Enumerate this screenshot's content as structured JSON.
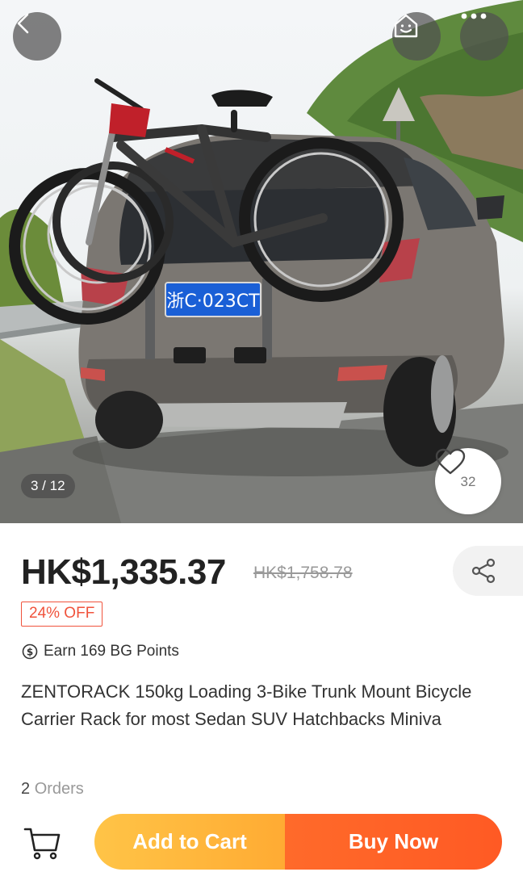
{
  "gallery": {
    "counter": "3 / 12",
    "plate_text": "浙C·023CT",
    "favorite_count": "32"
  },
  "product": {
    "price": "HK$1,335.37",
    "original_price": "HK$1,758.78",
    "discount": "24% OFF",
    "points": "Earn 169 BG Points",
    "title": "ZENTORACK 150kg Loading 3-Bike Trunk Mount Bicycle Carrier Rack for most Sedan SUV Hatchbacks Miniva",
    "orders_count": "2",
    "orders_label": "Orders"
  },
  "actions": {
    "add_to_cart": "Add to Cart",
    "buy_now": "Buy Now"
  },
  "icons": {
    "back": "chevron-left-icon",
    "home": "home-face-icon",
    "more": "more-dots-icon",
    "favorite": "heart-icon",
    "share": "share-icon",
    "points": "coin-icon",
    "cart": "cart-icon"
  },
  "colors": {
    "discount": "#f0533c",
    "add_to_cart": "#ffb33a",
    "buy_now": "#ff5f26"
  }
}
